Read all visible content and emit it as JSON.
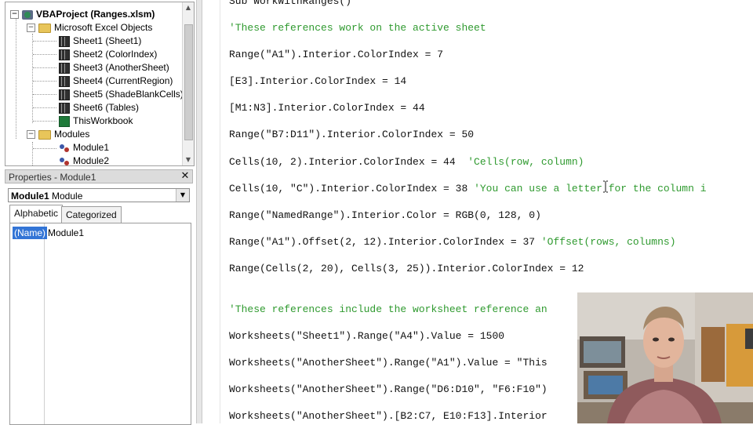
{
  "project_tree": {
    "root_label": "VBAProject (Ranges.xlsm)",
    "excel_objects_label": "Microsoft Excel Objects",
    "sheets": [
      "Sheet1 (Sheet1)",
      "Sheet2 (ColorIndex)",
      "Sheet3 (AnotherSheet)",
      "Sheet4 (CurrentRegion)",
      "Sheet5 (ShadeBlankCells)",
      "Sheet6 (Tables)"
    ],
    "workbook_label": "ThisWorkbook",
    "modules_label": "Modules",
    "modules": [
      "Module1",
      "Module2"
    ]
  },
  "properties": {
    "title": "Properties - Module1",
    "object_name": "Module1",
    "object_type": "Module",
    "tabs": [
      "Alphabetic",
      "Categorized"
    ],
    "active_tab": "Alphabetic",
    "rows": [
      {
        "name": "(Name)",
        "value": "Module1"
      }
    ]
  },
  "code": {
    "lines": [
      {
        "text": "Sub WorkWithRanges()",
        "comment": ""
      },
      {
        "text": "",
        "comment": "'These references work on the active sheet"
      },
      {
        "text": "Range(\"A1\").Interior.ColorIndex = 7",
        "comment": ""
      },
      {
        "text": "[E3].Interior.ColorIndex = 14",
        "comment": ""
      },
      {
        "text": "[M1:N3].Interior.ColorIndex = 44",
        "comment": ""
      },
      {
        "text": "Range(\"B7:D11\").Interior.ColorIndex = 50",
        "comment": ""
      },
      {
        "text": "Cells(10, 2).Interior.ColorIndex = 44  ",
        "comment": "'Cells(row, column)"
      },
      {
        "text": "Cells(10, \"C\").Interior.ColorIndex = 38 ",
        "comment": "'You can use a letter for the column i"
      },
      {
        "text": "Range(\"NamedRange\").Interior.Color = RGB(0, 128, 0)",
        "comment": ""
      },
      {
        "text": "Range(\"A1\").Offset(2, 12).Interior.ColorIndex = 37 ",
        "comment": "'Offset(rows, columns)"
      },
      {
        "text": "Range(Cells(2, 20), Cells(3, 25)).Interior.ColorIndex = 12",
        "comment": ""
      },
      {
        "text": "",
        "comment": "'These references include the worksheet reference an"
      },
      {
        "text": "Worksheets(\"Sheet1\").Range(\"A4\").Value = 1500",
        "comment": ""
      },
      {
        "text": "Worksheets(\"AnotherSheet\").Range(\"A1\").Value = \"This",
        "comment": ""
      },
      {
        "text": "Worksheets(\"AnotherSheet\").Range(\"D6:D10\", \"F6:F10\")",
        "comment": ""
      },
      {
        "text": "Worksheets(\"AnotherSheet\").[B2:C7, E10:F13].Interior",
        "comment": ""
      }
    ]
  },
  "colors": {
    "comment_green": "#2f9a2f",
    "selection_blue": "#3375d6"
  }
}
